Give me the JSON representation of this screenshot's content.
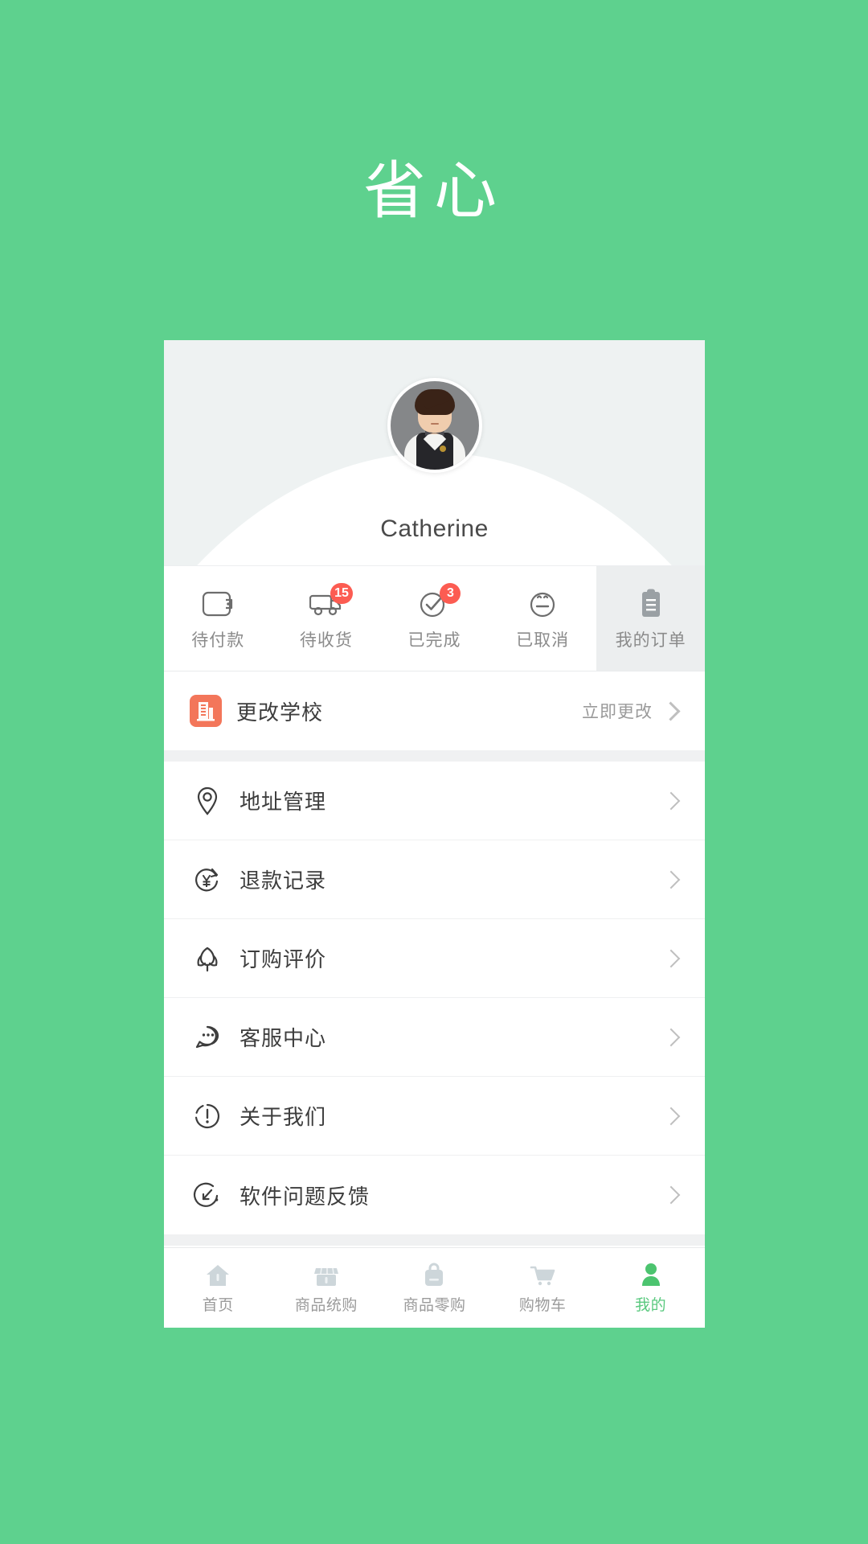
{
  "brand": {
    "logo_text": "省心"
  },
  "profile": {
    "username": "Catherine",
    "avatar_alt": "user-avatar"
  },
  "orders": {
    "tabs": [
      {
        "label": "待付款",
        "icon": "wallet-icon",
        "badge": "",
        "active": false
      },
      {
        "label": "待收货",
        "icon": "truck-icon",
        "badge": "15",
        "active": false
      },
      {
        "label": "已完成",
        "icon": "check-circle-icon",
        "badge": "3",
        "active": false
      },
      {
        "label": "已取消",
        "icon": "neutral-face-icon",
        "badge": "",
        "active": false
      },
      {
        "label": "我的订单",
        "icon": "clipboard-icon",
        "badge": "",
        "active": true
      }
    ]
  },
  "menu": {
    "school_row": {
      "label": "更改学校",
      "icon": "building-icon",
      "action": "立即更改"
    },
    "items": [
      {
        "label": "地址管理",
        "icon": "location-pin-icon"
      },
      {
        "label": "退款记录",
        "icon": "refund-yen-icon"
      },
      {
        "label": "订购评价",
        "icon": "flower-icon"
      },
      {
        "label": "客服中心",
        "icon": "chat-bubble-icon"
      },
      {
        "label": "关于我们",
        "icon": "info-circle-icon"
      },
      {
        "label": "软件问题反馈",
        "icon": "feedback-icon"
      }
    ]
  },
  "tabbar": {
    "items": [
      {
        "label": "首页",
        "icon": "home-icon",
        "active": false
      },
      {
        "label": "商品统购",
        "icon": "store-icon",
        "active": false
      },
      {
        "label": "商品零购",
        "icon": "bag-icon",
        "active": false
      },
      {
        "label": "购物车",
        "icon": "cart-icon",
        "active": false
      },
      {
        "label": "我的",
        "icon": "person-icon",
        "active": true
      }
    ]
  },
  "colors": {
    "background_green": "#5ed18e",
    "accent_green": "#5ac97f",
    "badge_red": "#fc5c52",
    "school_icon_orange": "#f3765a",
    "profile_header": "#eef2f2"
  }
}
